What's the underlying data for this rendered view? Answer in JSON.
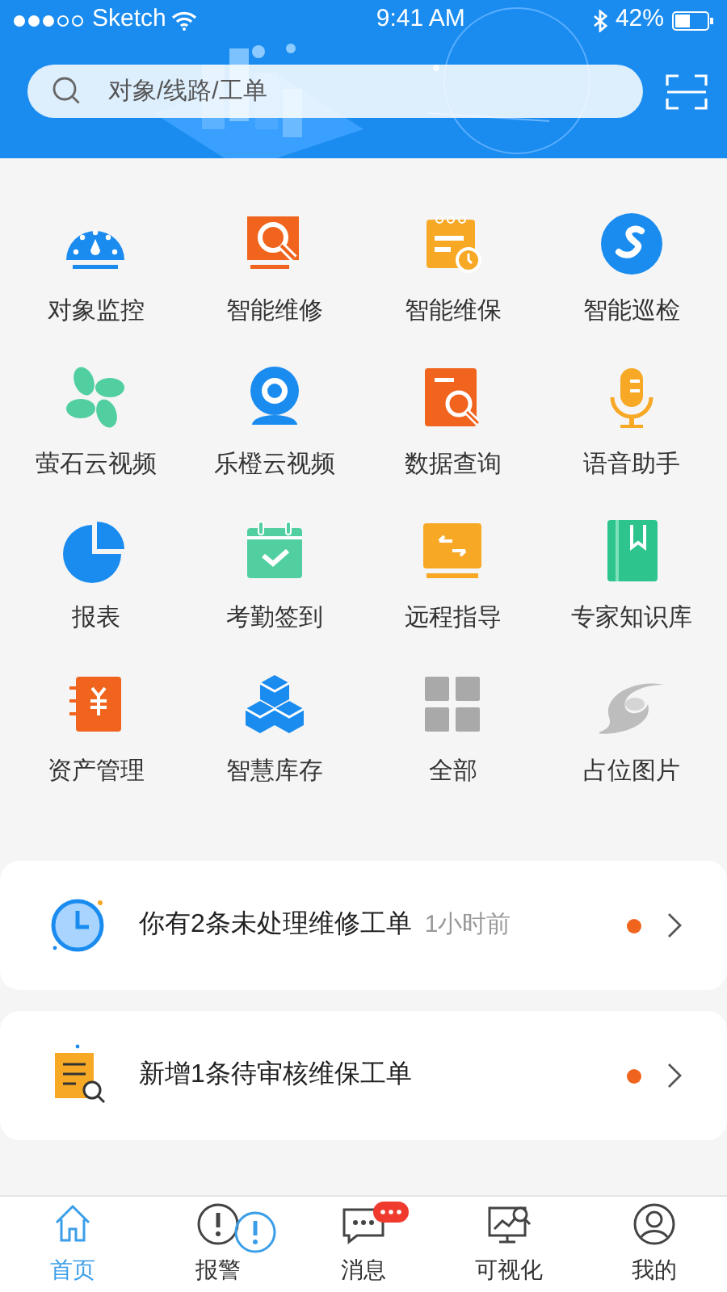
{
  "status_bar": {
    "carrier": "Sketch",
    "time": "9:41 AM",
    "battery": "42%"
  },
  "search": {
    "placeholder": "对象/线路/工单"
  },
  "apps": [
    {
      "label": "对象监控"
    },
    {
      "label": "智能维修"
    },
    {
      "label": "智能维保"
    },
    {
      "label": "智能巡检"
    },
    {
      "label": "萤石云视频"
    },
    {
      "label": "乐橙云视频"
    },
    {
      "label": "数据查询"
    },
    {
      "label": "语音助手"
    },
    {
      "label": "报表"
    },
    {
      "label": "考勤签到"
    },
    {
      "label": "远程指导"
    },
    {
      "label": "专家知识库"
    },
    {
      "label": "资产管理"
    },
    {
      "label": "智慧库存"
    },
    {
      "label": "全部"
    },
    {
      "label": "占位图片"
    }
  ],
  "notices": [
    {
      "kind": "clock",
      "text": "你有2条未处理维修工单",
      "time": "1小时前",
      "unread": true
    },
    {
      "kind": "document",
      "text": "新增1条待审核维保工单",
      "unread": true
    }
  ],
  "tab_bar": [
    {
      "label": "首页",
      "selected": true,
      "badge": false
    },
    {
      "label": "报警",
      "selected": false,
      "badge": false
    },
    {
      "label": "消息",
      "selected": false,
      "badge": true
    },
    {
      "label": "可视化",
      "selected": false,
      "badge": false
    },
    {
      "label": "我的",
      "selected": false,
      "badge": false
    }
  ]
}
